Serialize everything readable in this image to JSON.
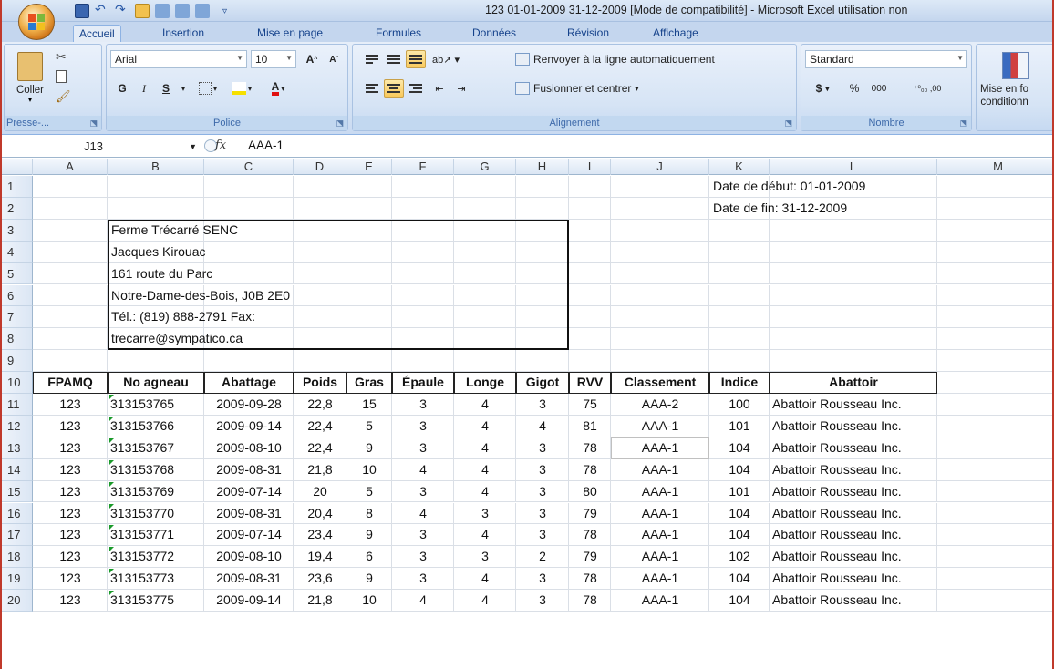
{
  "window": {
    "title": "123  01-01-2009  31-12-2009  [Mode de compatibilité] - Microsoft Excel utilisation non"
  },
  "tabs": [
    "Accueil",
    "Insertion",
    "Mise en page",
    "Formules",
    "Données",
    "Révision",
    "Affichage"
  ],
  "ribbon": {
    "clipboard": {
      "paste": "Coller",
      "label": "Presse-..."
    },
    "font": {
      "name": "Arial",
      "size": "10",
      "bold": "G",
      "italic": "I",
      "underline": "S",
      "label": "Police"
    },
    "alignment": {
      "wrap": "Renvoyer à la ligne automatiquement",
      "merge": "Fusionner et centrer",
      "label": "Alignement"
    },
    "number": {
      "format": "Standard",
      "currency": "$",
      "percent": "%",
      "thousands": "000",
      "inc": "⁺⁰₀₀ ,00",
      "label": "Nombre"
    },
    "styles": {
      "conditional": "Mise en fo",
      "conditional2": "conditionn"
    }
  },
  "formula_bar": {
    "name_box": "J13",
    "fx": "fx",
    "formula": "AAA-1"
  },
  "columns": [
    "A",
    "B",
    "C",
    "D",
    "E",
    "F",
    "G",
    "H",
    "I",
    "J",
    "K",
    "L",
    "M"
  ],
  "rows": [
    "1",
    "2",
    "3",
    "4",
    "5",
    "6",
    "7",
    "8",
    "9",
    "10",
    "11",
    "12",
    "13",
    "14",
    "15",
    "16",
    "17",
    "18",
    "19",
    "20"
  ],
  "sheet": {
    "date_start": "Date de début: 01-01-2009",
    "date_end": "Date de fin: 31-12-2009",
    "address": [
      "Ferme Trécarré SENC",
      "Jacques Kirouac",
      "161 route du Parc",
      "Notre-Dame-des-Bois, J0B 2E0",
      "Tél.: (819) 888-2791 Fax:",
      "trecarre@sympatico.ca"
    ],
    "headers": [
      "FPAMQ",
      "No agneau",
      "Abattage",
      "Poids",
      "Gras",
      "Épaule",
      "Longe",
      "Gigot",
      "RVV",
      "Classement",
      "Indice",
      "Abattoir"
    ],
    "data": [
      [
        "123",
        "313153765",
        "2009-09-28",
        "22,8",
        "15",
        "3",
        "4",
        "3",
        "75",
        "AAA-2",
        "100",
        "Abattoir Rousseau Inc."
      ],
      [
        "123",
        "313153766",
        "2009-09-14",
        "22,4",
        "5",
        "3",
        "4",
        "4",
        "81",
        "AAA-1",
        "101",
        "Abattoir Rousseau Inc."
      ],
      [
        "123",
        "313153767",
        "2009-08-10",
        "22,4",
        "9",
        "3",
        "4",
        "3",
        "78",
        "AAA-1",
        "104",
        "Abattoir Rousseau Inc."
      ],
      [
        "123",
        "313153768",
        "2009-08-31",
        "21,8",
        "10",
        "4",
        "4",
        "3",
        "78",
        "AAA-1",
        "104",
        "Abattoir Rousseau Inc."
      ],
      [
        "123",
        "313153769",
        "2009-07-14",
        "20",
        "5",
        "3",
        "4",
        "3",
        "80",
        "AAA-1",
        "101",
        "Abattoir Rousseau Inc."
      ],
      [
        "123",
        "313153770",
        "2009-08-31",
        "20,4",
        "8",
        "4",
        "3",
        "3",
        "79",
        "AAA-1",
        "104",
        "Abattoir Rousseau Inc."
      ],
      [
        "123",
        "313153771",
        "2009-07-14",
        "23,4",
        "9",
        "3",
        "4",
        "3",
        "78",
        "AAA-1",
        "104",
        "Abattoir Rousseau Inc."
      ],
      [
        "123",
        "313153772",
        "2009-08-10",
        "19,4",
        "6",
        "3",
        "3",
        "2",
        "79",
        "AAA-1",
        "102",
        "Abattoir Rousseau Inc."
      ],
      [
        "123",
        "313153773",
        "2009-08-31",
        "23,6",
        "9",
        "3",
        "4",
        "3",
        "78",
        "AAA-1",
        "104",
        "Abattoir Rousseau Inc."
      ],
      [
        "123",
        "313153775",
        "2009-09-14",
        "21,8",
        "10",
        "4",
        "4",
        "3",
        "78",
        "AAA-1",
        "104",
        "Abattoir Rousseau Inc."
      ]
    ]
  }
}
